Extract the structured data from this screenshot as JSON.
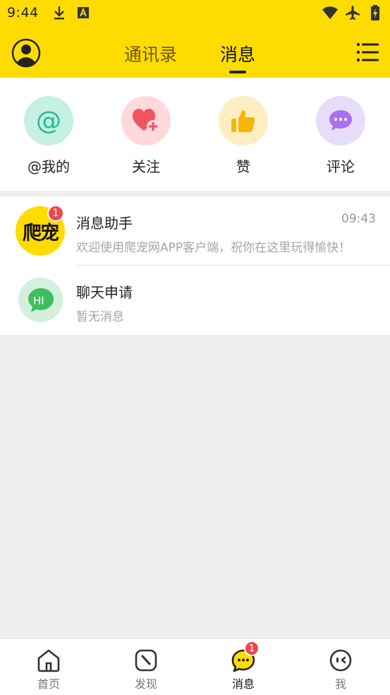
{
  "status_bar": {
    "time": "9:44",
    "left_icons": [
      "download-icon",
      "font-icon"
    ],
    "right_icons": [
      "wifi-icon",
      "airplane-icon",
      "battery-charging-icon"
    ]
  },
  "header": {
    "tabs": [
      {
        "label": "通讯录",
        "active": false
      },
      {
        "label": "消息",
        "active": true
      }
    ],
    "left_icon": "user-avatar-icon",
    "right_icon": "menu-list-icon",
    "background": "#ffdc00"
  },
  "quick_actions": [
    {
      "label": "@我的",
      "icon": "at-icon",
      "bg": "#c5f0e3",
      "color": "#1dbf8f"
    },
    {
      "label": "关注",
      "icon": "heart-plus-icon",
      "bg": "#ffd9dc",
      "color": "#f2545b"
    },
    {
      "label": "赞",
      "icon": "thumbs-up-icon",
      "bg": "#ffeec2",
      "color": "#f6b700"
    },
    {
      "label": "评论",
      "icon": "comment-icon",
      "bg": "#e8dcfb",
      "color": "#a871f0"
    }
  ],
  "messages": [
    {
      "title": "消息助手",
      "time": "09:43",
      "preview": "欢迎使用爬宠网APP客户端，祝你在这里玩得愉快！",
      "badge": "1",
      "avatar_text": "爬宠"
    },
    {
      "title": "聊天申请",
      "time": "",
      "preview": "暂无消息",
      "badge": "",
      "avatar_text": "HI"
    }
  ],
  "bottom_nav": [
    {
      "label": "首页",
      "icon": "home-icon",
      "active": false
    },
    {
      "label": "发现",
      "icon": "compass-icon",
      "active": false
    },
    {
      "label": "消息",
      "icon": "chat-bubble-icon",
      "active": true,
      "badge": "1"
    },
    {
      "label": "我",
      "icon": "profile-face-icon",
      "active": false
    }
  ]
}
